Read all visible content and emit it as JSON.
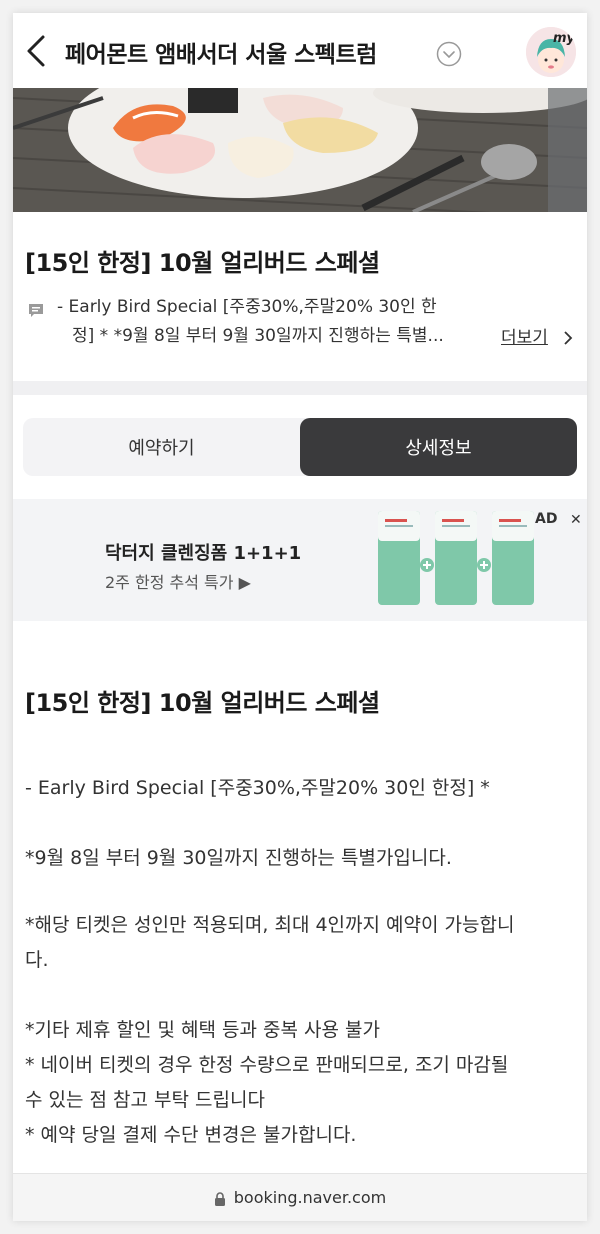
{
  "header": {
    "title": "페어몬트 앰배서더 서울 스펙트럼",
    "avatar_label": "my"
  },
  "offer": {
    "title": "[15인 한정] 10월 얼리버드 스페셜",
    "description_line1": "- Early Bird Special [주중30%,주말20% 30인 한",
    "description_line2": "정] * *9월 8일 부터 9월 30일까지 진행하는 특별...",
    "more_label": "더보기"
  },
  "tabs": [
    {
      "label": "예약하기",
      "active": false
    },
    {
      "label": "상세정보",
      "active": true
    }
  ],
  "ad": {
    "title": "닥터지 클렌징폼 1+1+1",
    "subtitle": "2주 한정 추석 특가 ▶",
    "badge": "AD",
    "close": "✕"
  },
  "detail": {
    "title": "[15인 한정] 10월 얼리버드 스페셜",
    "line1": "- Early Bird Special [주중30%,주말20% 30인 한정] *",
    "line2": "*9월 8일 부터 9월 30일까지 진행하는 특별가입니다.",
    "line3a": "*해당 티켓은 성인만 적용되며, 최대 4인까지 예약이 가능합니",
    "line3b": "다.",
    "line4": "*기타 제휴 할인 및 혜택 등과 중복 사용 불가",
    "line5a": "* 네이버 티켓의 경우 한정 수량으로 판매되므로, 조기 마감될",
    "line5b": "수 있는 점 참고 부탁 드립니다",
    "line6": "* 예약 당일 결제 수단 변경은 불가합니다."
  },
  "browser": {
    "url": "booking.naver.com"
  },
  "colors": {
    "active_tab_bg": "#3a3a3c",
    "ad_bg": "#f3f4f6",
    "tube_green": "#7fc8a9"
  }
}
